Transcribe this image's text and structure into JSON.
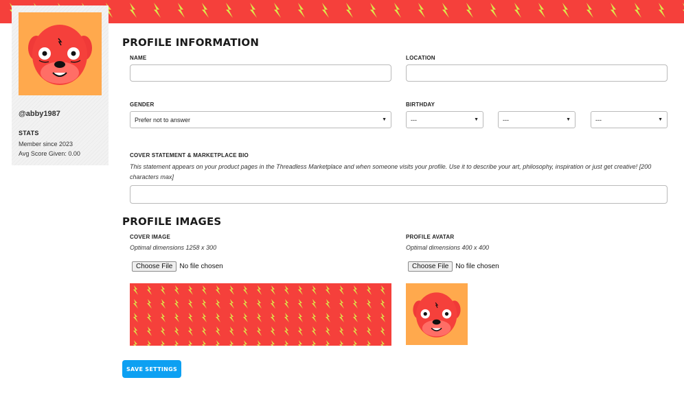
{
  "colors": {
    "banner": "#f5403b",
    "bolt": "#dbe84a",
    "avatar_bg": "#ffa94d",
    "button": "#0da0f2"
  },
  "sidebar": {
    "username": "@abby1987",
    "stats_heading": "STATS",
    "member_since": "Member since 2023",
    "avg_score": "Avg Score Given: 0.00"
  },
  "profile_info": {
    "heading": "PROFILE INFORMATION",
    "name_label": "NAME",
    "name_value": "",
    "location_label": "LOCATION",
    "location_value": "",
    "gender_label": "GENDER",
    "gender_value": "Prefer not to answer",
    "birthday_label": "BIRTHDAY",
    "birthday_month": "---",
    "birthday_day": "---",
    "birthday_year": "---",
    "bio_label": "COVER STATEMENT & MARKETPLACE BIO",
    "bio_hint": "This statement appears on your product pages in the Threadless Marketplace and when someone visits your profile. Use it to describe your art, philosophy, inspiration or just get creative! [200 characters max]",
    "bio_value": ""
  },
  "profile_images": {
    "heading": "PROFILE IMAGES",
    "cover_label": "COVER IMAGE",
    "cover_hint": "Optimal dimensions 1258 x 300",
    "avatar_label": "PROFILE AVATAR",
    "avatar_hint": "Optimal dimensions 400 x 400",
    "choose_file": "Choose File",
    "no_file": "No file chosen"
  },
  "save_label": "SAVE SETTINGS"
}
